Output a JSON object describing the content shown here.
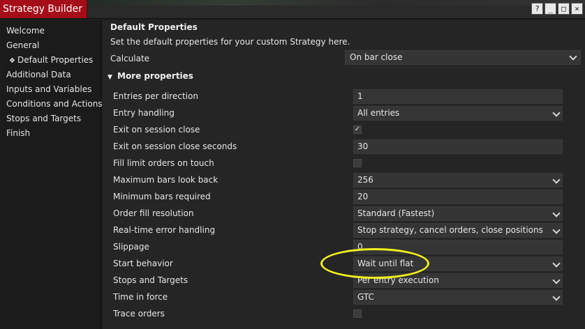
{
  "window": {
    "title": "Strategy Builder",
    "buttons": [
      "?",
      "_",
      "□",
      "×"
    ]
  },
  "sidebar": {
    "items": [
      {
        "label": "Welcome"
      },
      {
        "label": "General"
      },
      {
        "label": "Default Properties",
        "active": true
      },
      {
        "label": "Additional Data"
      },
      {
        "label": "Inputs and Variables"
      },
      {
        "label": "Conditions and Actions"
      },
      {
        "label": "Stops and Targets"
      },
      {
        "label": "Finish"
      }
    ]
  },
  "main": {
    "title": "Default Properties",
    "description": "Set the default properties for your custom Strategy here.",
    "calculate": {
      "label": "Calculate",
      "value": "On bar close"
    },
    "more_properties_label": "More properties",
    "properties": [
      {
        "label": "Entries per direction",
        "value": "1",
        "kind": "text"
      },
      {
        "label": "Entry handling",
        "value": "All entries",
        "kind": "select"
      },
      {
        "label": "Exit on session close",
        "value": "✓",
        "kind": "check"
      },
      {
        "label": "Exit on session close seconds",
        "value": "30",
        "kind": "text"
      },
      {
        "label": "Fill limit orders on touch",
        "value": "",
        "kind": "check"
      },
      {
        "label": "Maximum bars look back",
        "value": "256",
        "kind": "select"
      },
      {
        "label": "Minimum bars required",
        "value": "20",
        "kind": "text"
      },
      {
        "label": "Order fill resolution",
        "value": "Standard (Fastest)",
        "kind": "select"
      },
      {
        "label": "Real-time error handling",
        "value": "Stop strategy, cancel orders, close positions",
        "kind": "select"
      },
      {
        "label": "Slippage",
        "value": "0",
        "kind": "text"
      },
      {
        "label": "Start behavior",
        "value": "Wait until flat",
        "kind": "select"
      },
      {
        "label": "Stops and Targets",
        "value": "Per entry execution",
        "kind": "select"
      },
      {
        "label": "Time in force",
        "value": "GTC",
        "kind": "select"
      },
      {
        "label": "Trace orders",
        "value": "",
        "kind": "check"
      }
    ]
  },
  "colors": {
    "title_accent": "#a50d18",
    "highlight": "#f2ef1e",
    "background": "#252526"
  }
}
